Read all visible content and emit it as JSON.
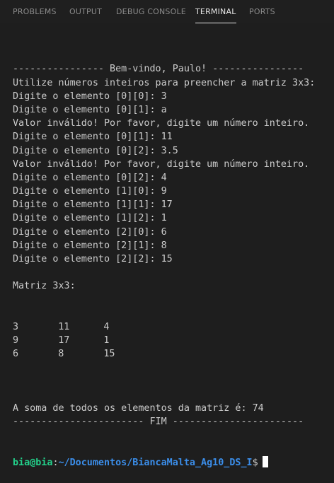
{
  "panel_tabs": [
    {
      "label": "PROBLEMS",
      "active": false
    },
    {
      "label": "OUTPUT",
      "active": false
    },
    {
      "label": "DEBUG CONSOLE",
      "active": false
    },
    {
      "label": "TERMINAL",
      "active": true
    },
    {
      "label": "PORTS",
      "active": false
    }
  ],
  "terminal": {
    "lines_before_matrix": [
      "---------------- Bem-vindo, Paulo! ----------------",
      "Utilize números inteiros para preencher a matriz 3x3:",
      "Digite o elemento [0][0]: 3",
      "Digite o elemento [0][1]: a",
      "Valor inválido! Por favor, digite um número inteiro.",
      "Digite o elemento [0][1]: 11",
      "Digite o elemento [0][2]: 3.5",
      "Valor inválido! Por favor, digite um número inteiro.",
      "Digite o elemento [0][2]: 4",
      "Digite o elemento [1][0]: 9",
      "Digite o elemento [1][1]: 17",
      "Digite o elemento [1][2]: 1",
      "Digite o elemento [2][0]: 6",
      "Digite o elemento [2][1]: 8",
      "Digite o elemento [2][2]: 15",
      "",
      "Matriz 3x3:"
    ],
    "matrix": [
      [
        "3",
        "11",
        "4"
      ],
      [
        "9",
        "17",
        "1"
      ],
      [
        "6",
        "8",
        "15"
      ]
    ],
    "lines_after_matrix": [
      "",
      "A soma de todos os elementos da matriz é: 74",
      "----------------------- FIM -----------------------"
    ],
    "prompt": {
      "user_host": "bia@bia",
      "separator": ":",
      "path": "~/Documentos/BiancaMalta_Ag10_DS_I",
      "symbol": "$"
    }
  },
  "colors": {
    "background": "#1e1e1e",
    "text": "#cccccc",
    "prompt_user": "#23d18b",
    "prompt_path": "#3b8eea",
    "active_tab": "#e7e7e7",
    "inactive_tab": "#8b8b8b"
  }
}
